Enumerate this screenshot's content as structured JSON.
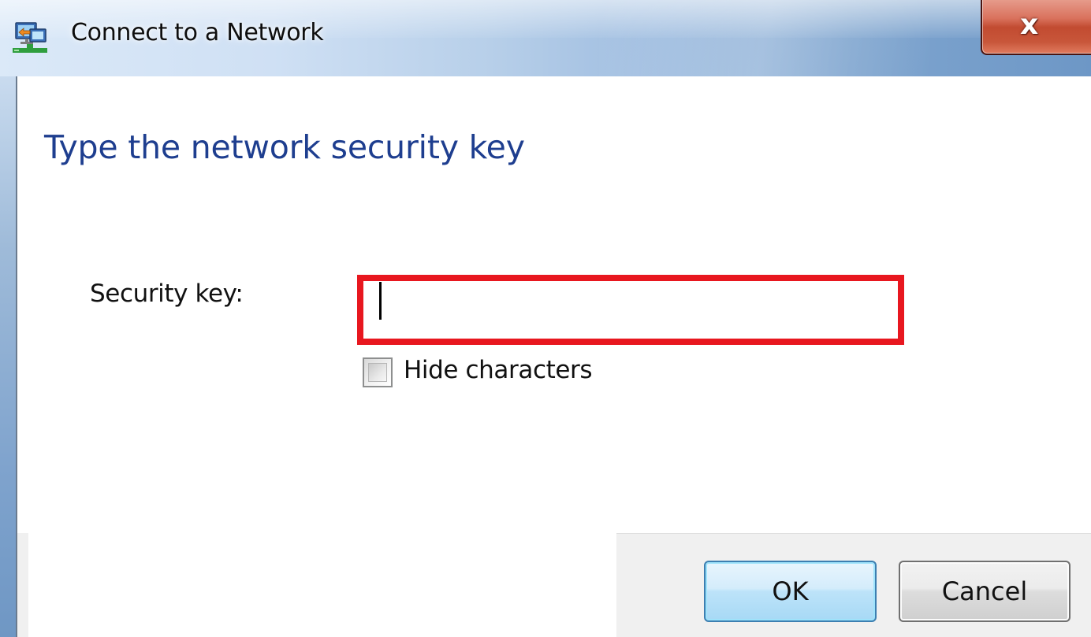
{
  "window": {
    "title": "Connect to a Network",
    "close_label": "x",
    "icon": "network-connect-icon"
  },
  "main": {
    "instruction": "Type the network security key",
    "security_key_label": "Security key:",
    "security_key_value": "",
    "hide_characters_label": "Hide characters",
    "hide_characters_checked": false
  },
  "buttons": {
    "ok_label": "OK",
    "cancel_label": "Cancel"
  },
  "colors": {
    "instruction_text": "#1e3e8f",
    "highlight_border": "#e8171f",
    "ok_button_border": "#3c7fb1"
  }
}
